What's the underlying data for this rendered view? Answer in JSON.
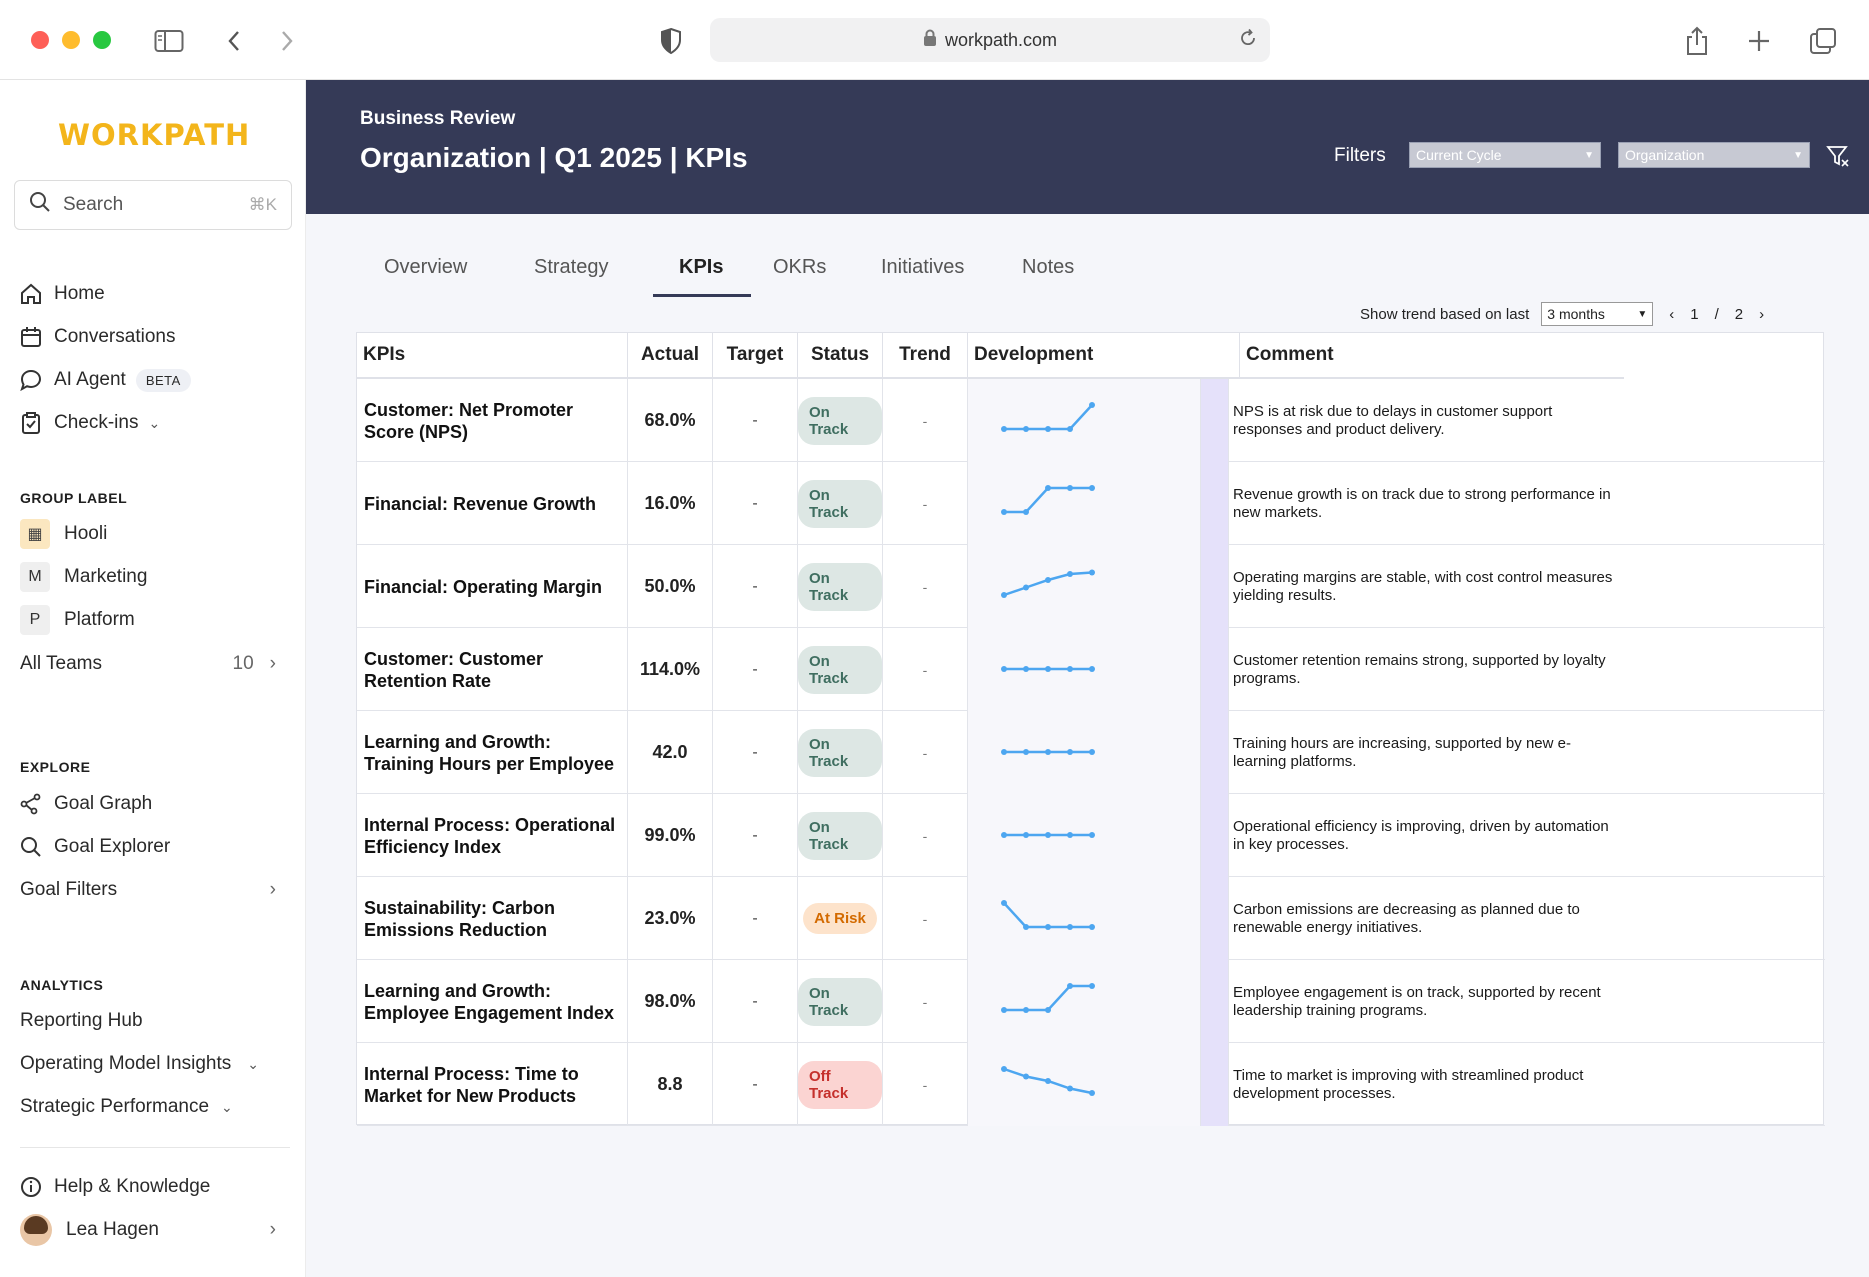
{
  "browser": {
    "url": "workpath.com"
  },
  "sidebar": {
    "logo": "WORKPATH",
    "search": {
      "label": "Search",
      "shortcut": "⌘K"
    },
    "nav": [
      {
        "label": "Home",
        "icon": "home-icon"
      },
      {
        "label": "Conversations",
        "icon": "calendar-icon"
      },
      {
        "label": "AI Agent",
        "icon": "chat-bubble-icon",
        "badge": "BETA"
      },
      {
        "label": "Check-ins",
        "icon": "clipboard-icon"
      }
    ],
    "group_label": "GROUP LABEL",
    "teams": [
      {
        "label": "Hooli",
        "badge": "▦"
      },
      {
        "label": "Marketing",
        "badge": "M"
      },
      {
        "label": "Platform",
        "badge": "P"
      }
    ],
    "all_teams": {
      "label": "All Teams",
      "count": "10"
    },
    "explore_label": "EXPLORE",
    "explore": [
      {
        "label": "Goal Graph",
        "icon": "graph-icon"
      },
      {
        "label": "Goal Explorer",
        "icon": "search-icon"
      }
    ],
    "goal_filters": "Goal Filters",
    "analytics_label": "ANALYTICS",
    "analytics": [
      {
        "label": "Reporting Hub"
      },
      {
        "label": "Operating Model Insights"
      },
      {
        "label": "Strategic Performance"
      }
    ],
    "help": "Help & Knowledge",
    "user": "Lea Hagen"
  },
  "header": {
    "subtitle": "Business Review",
    "title": "Organization | Q1 2025 | KPIs",
    "filters_label": "Filters",
    "filter1": "Current Cycle",
    "filter2": "Organization"
  },
  "tabs": [
    "Overview",
    "Strategy",
    "KPIs",
    "OKRs",
    "Initiatives",
    "Notes"
  ],
  "active_tab": "KPIs",
  "trend_control": {
    "label": "Show trend based on last",
    "value": "3 months",
    "page": "1",
    "sep": "/",
    "total": "2"
  },
  "table": {
    "columns": [
      "KPIs",
      "Actual",
      "Target",
      "Status",
      "Trend",
      "Development",
      "Comment"
    ],
    "rows": [
      {
        "kpi": "Customer: Net Promoter Score (NPS)",
        "actual": "68.0%",
        "target": "-",
        "status": "On Track",
        "trend": "-",
        "spark": [
          0.2,
          0.2,
          0.2,
          0.2,
          1.0
        ],
        "comment": "NPS is at risk due to delays in customer support responses and product delivery."
      },
      {
        "kpi": "Financial: Revenue Growth",
        "actual": "16.0%",
        "target": "-",
        "status": "On Track",
        "trend": "-",
        "spark": [
          0.2,
          0.2,
          1.0,
          1.0,
          1.0
        ],
        "comment": "Revenue growth is on track due to strong performance in new markets."
      },
      {
        "kpi": "Financial: Operating Margin",
        "actual": "50.0%",
        "target": "-",
        "status": "On Track",
        "trend": "-",
        "spark": [
          0.2,
          0.45,
          0.7,
          0.9,
          0.95
        ],
        "comment": "Operating margins are stable, with cost control measures yielding results."
      },
      {
        "kpi": "Customer: Customer Retention Rate",
        "actual": "114.0%",
        "target": "-",
        "status": "On Track",
        "trend": "-",
        "spark": [
          0.5,
          0.5,
          0.5,
          0.5,
          0.5
        ],
        "comment": "Customer retention remains strong, supported by loyalty programs."
      },
      {
        "kpi": "Learning and Growth: Training Hours per Employee",
        "actual": "42.0",
        "target": "-",
        "status": "On Track",
        "trend": "-",
        "spark": [
          0.5,
          0.5,
          0.5,
          0.5,
          0.5
        ],
        "comment": "Training hours are increasing, supported by new e-learning platforms."
      },
      {
        "kpi": "Internal Process: Operational Efficiency Index",
        "actual": "99.0%",
        "target": "-",
        "status": "On Track",
        "trend": "-",
        "spark": [
          0.5,
          0.5,
          0.5,
          0.5,
          0.5
        ],
        "comment": "Operational efficiency is improving, driven by automation in key processes."
      },
      {
        "kpi": "Sustainability: Carbon Emissions Reduction",
        "actual": "23.0%",
        "target": "-",
        "status": "At Risk",
        "trend": "-",
        "spark": [
          1.0,
          0.2,
          0.2,
          0.2,
          0.2
        ],
        "comment": "Carbon emissions are decreasing as planned due to renewable energy initiatives."
      },
      {
        "kpi": "Learning and Growth: Employee Engagement Index",
        "actual": "98.0%",
        "target": "-",
        "status": "On Track",
        "trend": "-",
        "spark": [
          0.2,
          0.2,
          0.2,
          1.0,
          1.0
        ],
        "comment": "Employee engagement is on track, supported by recent leadership training programs."
      },
      {
        "kpi": "Internal Process: Time to Market for New Products",
        "actual": "8.8",
        "target": "-",
        "status": "Off Track",
        "trend": "-",
        "spark": [
          1.0,
          0.75,
          0.6,
          0.35,
          0.2
        ],
        "comment": "Time to market is improving with streamlined product development processes."
      }
    ]
  },
  "colors": {
    "banner": "#353a57",
    "accent": "#f3b51b",
    "spark": "#4da6f0",
    "on_track": "#3f6e60",
    "at_risk": "#d36a00",
    "off_track": "#c5302c"
  }
}
